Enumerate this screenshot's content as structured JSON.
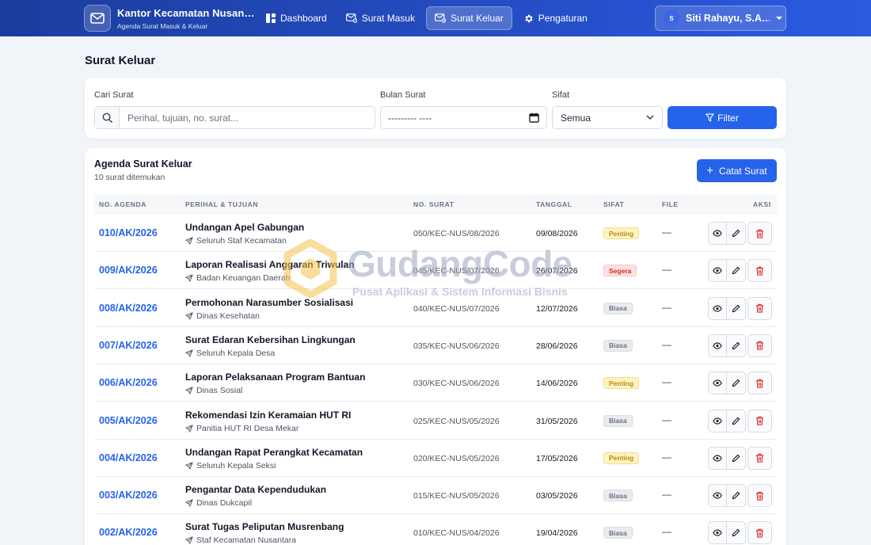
{
  "app": {
    "title": "Kantor Kecamatan Nusan…",
    "subtitle": "Agenda Surat Masuk & Keluar"
  },
  "nav": {
    "items": [
      {
        "label": "Dashboard",
        "icon": "dashboard-icon"
      },
      {
        "label": "Surat Masuk",
        "icon": "inbox-mail-icon"
      },
      {
        "label": "Surat Keluar",
        "icon": "outbox-mail-icon",
        "active": true
      },
      {
        "label": "Pengaturan",
        "icon": "gear-icon"
      }
    ]
  },
  "user": {
    "initial": "S",
    "name": "Siti Rahayu, S.A…"
  },
  "page": {
    "title": "Surat Keluar"
  },
  "filter": {
    "search_label": "Cari Surat",
    "search_placeholder": "Perihal, tujuan, no. surat...",
    "month_label": "Bulan Surat",
    "month_value": "--------- ----",
    "sifat_label": "Sifat",
    "sifat_value": "Semua",
    "button_label": "Filter"
  },
  "table": {
    "title": "Agenda Surat Keluar",
    "count_text": "10 surat ditemukan",
    "add_button": "Catat Surat",
    "columns": [
      "NO. AGENDA",
      "PERIHAL & TUJUAN",
      "NO. SURAT",
      "TANGGAL",
      "SIFAT",
      "FILE",
      "AKSI"
    ],
    "rows": [
      {
        "agenda": "010/AK/2026",
        "perihal": "Undangan Apel Gabungan",
        "tujuan": "Seluruh Staf Kecamatan",
        "no_surat": "050/KEC-NUS/08/2026",
        "tanggal": "09/08/2026",
        "sifat": "Penting",
        "file": "—"
      },
      {
        "agenda": "009/AK/2026",
        "perihal": "Laporan Realisasi Anggaran Triwulan",
        "tujuan": "Badan Keuangan Daerah",
        "no_surat": "045/KEC-NUS/07/2026",
        "tanggal": "26/07/2026",
        "sifat": "Segera",
        "file": "—"
      },
      {
        "agenda": "008/AK/2026",
        "perihal": "Permohonan Narasumber Sosialisasi",
        "tujuan": "Dinas Kesehatan",
        "no_surat": "040/KEC-NUS/07/2026",
        "tanggal": "12/07/2026",
        "sifat": "Biasa",
        "file": "—"
      },
      {
        "agenda": "007/AK/2026",
        "perihal": "Surat Edaran Kebersihan Lingkungan",
        "tujuan": "Seluruh Kepala Desa",
        "no_surat": "035/KEC-NUS/06/2026",
        "tanggal": "28/06/2026",
        "sifat": "Biasa",
        "file": "—"
      },
      {
        "agenda": "006/AK/2026",
        "perihal": "Laporan Pelaksanaan Program Bantuan",
        "tujuan": "Dinas Sosial",
        "no_surat": "030/KEC-NUS/06/2026",
        "tanggal": "14/06/2026",
        "sifat": "Penting",
        "file": "—"
      },
      {
        "agenda": "005/AK/2026",
        "perihal": "Rekomendasi Izin Keramaian HUT RI",
        "tujuan": "Panitia HUT RI Desa Mekar",
        "no_surat": "025/KEC-NUS/05/2026",
        "tanggal": "31/05/2026",
        "sifat": "Biasa",
        "file": "—"
      },
      {
        "agenda": "004/AK/2026",
        "perihal": "Undangan Rapat Perangkat Kecamatan",
        "tujuan": "Seluruh Kepala Seksi",
        "no_surat": "020/KEC-NUS/05/2026",
        "tanggal": "17/05/2026",
        "sifat": "Penting",
        "file": "—"
      },
      {
        "agenda": "003/AK/2026",
        "perihal": "Pengantar Data Kependudukan",
        "tujuan": "Dinas Dukcapil",
        "no_surat": "015/KEC-NUS/05/2026",
        "tanggal": "03/05/2026",
        "sifat": "Biasa",
        "file": "—"
      },
      {
        "agenda": "002/AK/2026",
        "perihal": "Surat Tugas Peliputan Musrenbang",
        "tujuan": "Staf Kecamatan Nusantara",
        "no_surat": "010/KEC-NUS/04/2026",
        "tanggal": "19/04/2026",
        "sifat": "Biasa",
        "file": "—"
      }
    ]
  },
  "watermark": {
    "title": "GudangCode",
    "subtitle": "Pusat Aplikasi & Sistem Informasi Bisnis"
  },
  "colors": {
    "navbar_start": "#1c3d9e",
    "navbar_end": "#2b5ae0",
    "primary": "#2563eb",
    "penting": "#c08a0a",
    "segera": "#d92d20",
    "biasa": "#6b7280"
  }
}
